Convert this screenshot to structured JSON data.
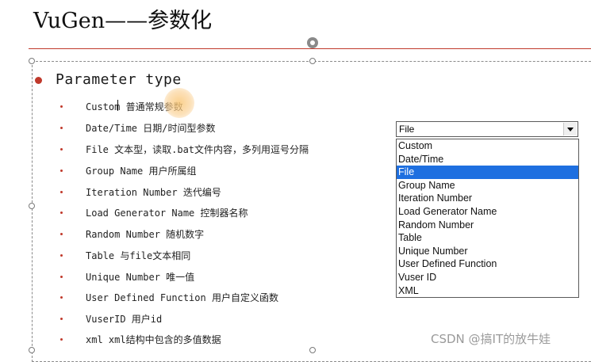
{
  "slide": {
    "title": "VuGen——参数化",
    "accent_color": "#c0392b"
  },
  "content": {
    "heading": "Parameter type",
    "items": [
      "Custom 普通常规参数",
      "Date/Time 日期/时间型参数",
      "File 文本型，读取.bat文件内容，多列用逗号分隔",
      "Group Name 用户所属组",
      "Iteration Number 迭代编号",
      "Load Generator Name 控制器名称",
      "Random Number 随机数字",
      "Table 与file文本相同",
      "Unique Number 唯一值",
      "User Defined Function 用户自定义函数",
      "VuserID 用户id",
      "xml xml结构中包含的多值数据"
    ]
  },
  "dropdown": {
    "selected_value": "File",
    "options": [
      "Custom",
      "Date/Time",
      "File",
      "Group Name",
      "Iteration Number",
      "Load Generator Name",
      "Random Number",
      "Table",
      "Unique Number",
      "User Defined Function",
      "Vuser ID",
      "XML"
    ],
    "highlight_color": "#1e6fe0"
  },
  "watermark": "CSDN @搞IT的放牛娃"
}
